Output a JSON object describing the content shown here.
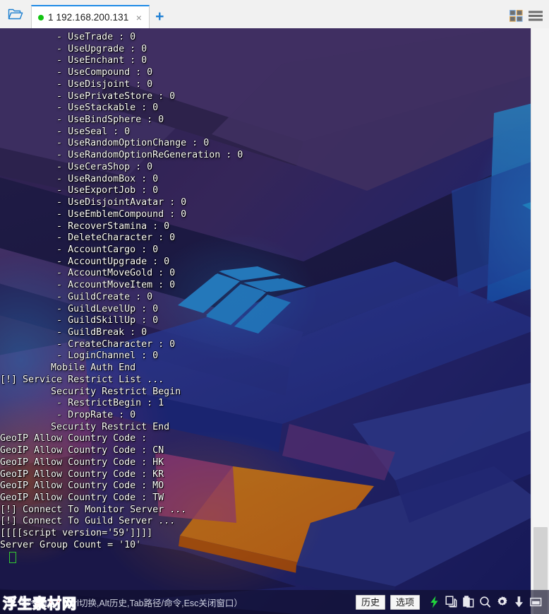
{
  "window": {
    "folder_icon": "folder-open-icon",
    "grid_icon": "grid-layout-icon",
    "menu_icon": "hamburger-menu-icon"
  },
  "tabs": [
    {
      "status_dot": "connected-green-dot",
      "label": "1 192.168.200.131",
      "close_label": "×",
      "active": true
    }
  ],
  "new_tab_label": "+",
  "terminal": {
    "cursor": "block-cursor",
    "lines": [
      "          - UseTrade : 0",
      "          - UseUpgrade : 0",
      "          - UseEnchant : 0",
      "          - UseCompound : 0",
      "          - UseDisjoint : 0",
      "          - UsePrivateStore : 0",
      "          - UseStackable : 0",
      "          - UseBindSphere : 0",
      "          - UseSeal : 0",
      "          - UseRandomOptionChange : 0",
      "          - UseRandomOptionReGeneration : 0",
      "          - UseCeraShop : 0",
      "          - UseRandomBox : 0",
      "          - UseExportJob : 0",
      "          - UseDisjointAvatar : 0",
      "          - UseEmblemCompound : 0",
      "          - RecoverStamina : 0",
      "          - DeleteCharacter : 0",
      "          - AccountCargo : 0",
      "          - AccountUpgrade : 0",
      "          - AccountMoveGold : 0",
      "          - AccountMoveItem : 0",
      "          - GuildCreate : 0",
      "          - GuildLevelUp : 0",
      "          - GuildSkillUp : 0",
      "          - GuildBreak : 0",
      "          - CreateCharacter : 0",
      "          - LoginChannel : 0",
      "         Mobile Auth End",
      "[!] Service Restrict List ...",
      "         Security Restrict Begin",
      "          - RestrictBegin : 1",
      "          - DropRate : 0",
      "         Security Restrict End",
      "GeoIP Allow Country Code : ",
      "GeoIP Allow Country Code : CN",
      "GeoIP Allow Country Code : HK",
      "GeoIP Allow Country Code : KR",
      "GeoIP Allow Country Code : MO",
      "GeoIP Allow Country Code : TW",
      "[!] Connect To Monitor Server ...",
      "[!] Connect To Guild Server ...",
      "[[[[script version='59']]]]",
      "Server Group Count = '10'"
    ]
  },
  "statusbar": {
    "input_placeholder": "命令输入（Ctrl切换,Alt历史,Tab路径/命令,Esc关闭窗口）",
    "input_value": "",
    "history_button": "历史",
    "options_button": "选项",
    "icons": [
      {
        "name": "lightning-icon",
        "color": "#21d63c"
      },
      {
        "name": "copy-icon",
        "color": "#e8e8ee"
      },
      {
        "name": "paste-icon",
        "color": "#e8e8ee"
      },
      {
        "name": "search-icon",
        "color": "#e8e8ee"
      },
      {
        "name": "gear-icon",
        "color": "#e8e8ee"
      },
      {
        "name": "download-icon",
        "color": "#e8e8ee"
      },
      {
        "name": "window-icon",
        "color": "#e8e8ee"
      }
    ]
  },
  "watermark": "浮生素材网",
  "colors": {
    "tab_accent": "#1e8ae6",
    "status_dot": "#13c413",
    "cursor": "#33c933",
    "wallpaper_purple": "#5c4486",
    "wallpaper_blue": "#2f46b8",
    "wallpaper_orange": "#f98a1c",
    "wallpaper_cyan": "#18a9ef",
    "wallpaper_magenta": "#c0479a"
  }
}
